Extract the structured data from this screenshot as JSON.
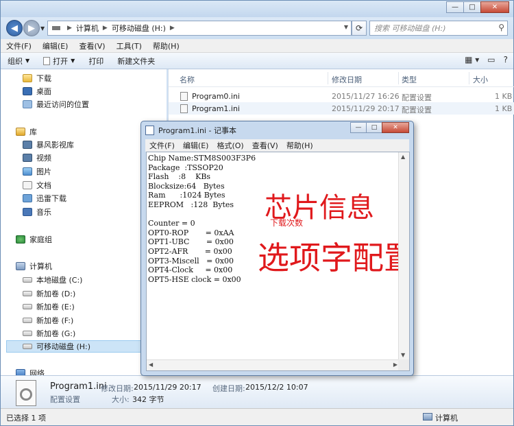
{
  "explorer": {
    "window_buttons": {
      "minimize": "—",
      "maximize": "□",
      "close": "✕"
    },
    "breadcrumb": [
      "计算机",
      "可移动磁盘 (H:)"
    ],
    "search_placeholder": "搜索 可移动磁盘 (H:)",
    "menu": [
      "文件(F)",
      "编辑(E)",
      "查看(V)",
      "工具(T)",
      "帮助(H)"
    ],
    "toolbar": {
      "organize": "组织",
      "open": "打开",
      "print": "打印",
      "new_folder": "新建文件夹"
    },
    "nav": {
      "downloads": "下载",
      "desktop": "桌面",
      "recent": "最近访问的位置",
      "libraries": "库",
      "storm": "暴风影视库",
      "videos": "视频",
      "pictures": "图片",
      "documents": "文档",
      "xunlei": "迅雷下载",
      "music": "音乐",
      "homegroup": "家庭组",
      "computer": "计算机",
      "drive_c": "本地磁盘 (C:)",
      "drive_d": "新加卷 (D:)",
      "drive_e": "新加卷 (E:)",
      "drive_f": "新加卷 (F:)",
      "drive_g": "新加卷 (G:)",
      "drive_h": "可移动磁盘 (H:)",
      "network": "网络"
    },
    "columns": {
      "name": "名称",
      "modified": "修改日期",
      "type": "类型",
      "size": "大小"
    },
    "files": [
      {
        "name": "Program0.ini",
        "modified": "2015/11/27 16:26",
        "type": "配置设置",
        "size": "1 KB"
      },
      {
        "name": "Program1.ini",
        "modified": "2015/11/29 20:17",
        "type": "配置设置",
        "size": "1 KB"
      }
    ],
    "details": {
      "filename": "Program1.ini",
      "modified_label": "修改日期:",
      "modified": "2015/11/29 20:17",
      "created_label": "创建日期:",
      "created": "2015/12/2 10:07",
      "type": "配置设置",
      "size_label": "大小:",
      "size": "342 字节"
    },
    "status": {
      "selected": "已选择 1 项",
      "location": "计算机"
    }
  },
  "notepad": {
    "title": "Program1.ini - 记事本",
    "window_buttons": {
      "minimize": "—",
      "maximize": "□",
      "close": "✕"
    },
    "menu": [
      "文件(F)",
      "编辑(E)",
      "格式(O)",
      "查看(V)",
      "帮助(H)"
    ],
    "content": "Chip Name:STM8S003F3P6\nPackage  :TSSOP20\nFlash    :8    KBs\nBlocksize:64   Bytes\nRam      :1024 Bytes\nEEPROM   :128  Bytes\n\nCounter = 0\nOPT0-ROP       = 0xAA\nOPT1-UBC       = 0x00\nOPT2-AFR       = 0x00\nOPT3-Miscell   = 0x00\nOPT4-Clock     = 0x00\nOPT5-HSE clock = 0x00",
    "annotations": {
      "chip_info": "芯片信息",
      "download_count": "下载次数",
      "option_config": "选项字配置"
    }
  }
}
